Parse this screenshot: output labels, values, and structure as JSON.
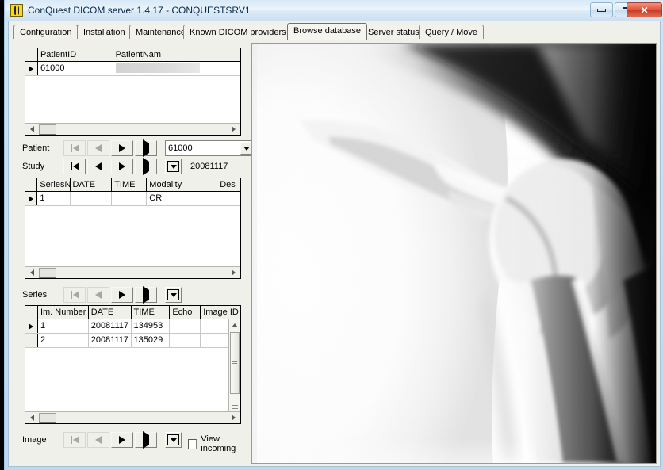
{
  "window": {
    "title": "ConQuest DICOM server 1.4.17 - CONQUESTSRV1",
    "icon": "conquest-app-icon",
    "controls": {
      "minimize": "minimize-icon",
      "maximize": "maximize-icon",
      "close": "✕"
    }
  },
  "tabs": [
    {
      "label": "Configuration",
      "active": false
    },
    {
      "label": "Installation",
      "active": false
    },
    {
      "label": "Maintenance",
      "active": false
    },
    {
      "label": "Known DICOM providers",
      "active": false
    },
    {
      "label": "Browse database",
      "active": true
    },
    {
      "label": "Server status",
      "active": false
    },
    {
      "label": "Query / Move",
      "active": false
    }
  ],
  "patient_grid": {
    "columns": [
      "PatientID",
      "PatientNam"
    ],
    "rows": [
      {
        "selected": true,
        "PatientID": "61000",
        "PatientNam": ""
      }
    ]
  },
  "patient_nav": {
    "label": "Patient",
    "buttons": [
      "first",
      "previous",
      "next",
      "last"
    ],
    "disabled": [
      "first",
      "previous"
    ],
    "combo_value": "61000"
  },
  "study_nav": {
    "label": "Study",
    "buttons": [
      "first",
      "previous",
      "next",
      "last"
    ],
    "disabled": [],
    "value": "20081117"
  },
  "series_grid": {
    "columns": [
      "SeriesNu",
      "DATE",
      "TIME",
      "Modality",
      "Des"
    ],
    "rows": [
      {
        "selected": true,
        "SeriesNu": "1",
        "DATE": "",
        "TIME": "",
        "Modality": "CR",
        "Des": ""
      }
    ]
  },
  "series_nav": {
    "label": "Series",
    "buttons": [
      "first",
      "previous",
      "next",
      "last"
    ],
    "disabled": [
      "first",
      "previous"
    ]
  },
  "image_grid": {
    "columns": [
      "Im. Number",
      "DATE",
      "TIME",
      "Echo",
      "Image ID"
    ],
    "rows": [
      {
        "selected": true,
        "Im. Number": "1",
        "DATE": "20081117",
        "TIME": "134953",
        "Echo": "",
        "Image ID": ""
      },
      {
        "selected": false,
        "Im. Number": "2",
        "DATE": "20081117",
        "TIME": "135029",
        "Echo": "",
        "Image ID": ""
      }
    ]
  },
  "image_nav": {
    "label": "Image",
    "buttons": [
      "first",
      "previous",
      "next",
      "last"
    ],
    "disabled": [
      "first",
      "previous"
    ],
    "view_incoming": {
      "label": "View incoming",
      "checked": false
    }
  },
  "viewer": {
    "modality": "CR",
    "description": "shoulder radiograph preview",
    "background": "#000000"
  },
  "colors": {
    "frame": "#cfe4f5",
    "titlebar": "#eaf4fc",
    "close_button": "#cc3b22",
    "client": "#f0f0eb",
    "grid_background": "#ffffff",
    "viewer_background": "#000000"
  }
}
